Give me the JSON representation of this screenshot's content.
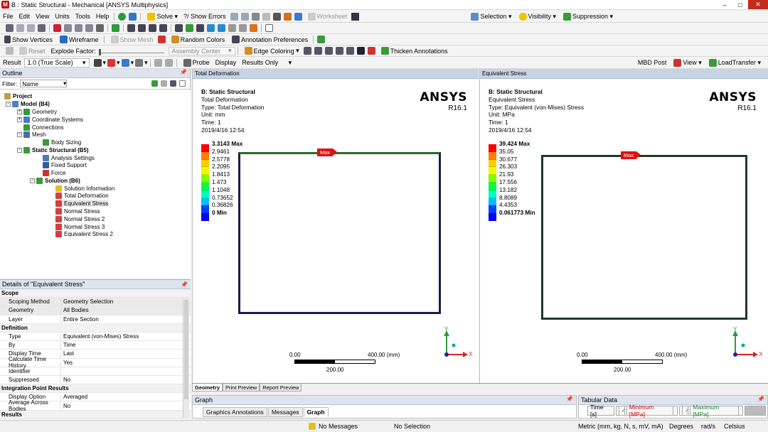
{
  "title": "B : Static Structural - Mechanical [ANSYS Multiphysics]",
  "app_icon": "M",
  "window_buttons": {
    "minimize": "–",
    "maximize": "□",
    "close": "✕"
  },
  "menu": [
    "File",
    "Edit",
    "View",
    "Units",
    "Tools",
    "Help"
  ],
  "toolbar1": {
    "solve": "Solve",
    "show_errors": "?/ Show Errors",
    "worksheet": "Worksheet",
    "selection": "Selection",
    "visibility": "Visibility",
    "suppression": "Suppression"
  },
  "toolbar3": {
    "show_vertices": "Show Vertices",
    "wireframe": "Wireframe",
    "show_mesh": "Show Mesh",
    "random_colors": "Random Colors",
    "annotation_prefs": "Annotation Preferences"
  },
  "toolbar4": {
    "reset": "Reset",
    "explode_factor": "Explode Factor:",
    "assembly_center": "Assembly Center",
    "edge_coloring": "Edge Coloring",
    "thicken": "Thicken Annotations"
  },
  "toolbar5": {
    "result_label": "Result",
    "scale_value": "1.0 (True Scale)",
    "probe": "Probe",
    "display_label": "Display",
    "display_value": "Results Only",
    "mbd_post": "MBD Post",
    "view": "View",
    "load_transfer": "LoadTransfer"
  },
  "outline": {
    "header": "Outline",
    "filter_label": "Filter:",
    "filter_value": "Name",
    "nodes": [
      {
        "label": "Project",
        "bold": true
      },
      {
        "label": "Model (B4)",
        "bold": true
      },
      {
        "label": "Geometry"
      },
      {
        "label": "Coordinate Systems"
      },
      {
        "label": "Connections"
      },
      {
        "label": "Mesh"
      },
      {
        "label": "Body Sizing"
      },
      {
        "label": "Static Structural (B5)",
        "bold": true
      },
      {
        "label": "Analysis Settings"
      },
      {
        "label": "Fixed Support"
      },
      {
        "label": "Force"
      },
      {
        "label": "Solution (B6)",
        "bold": true
      },
      {
        "label": "Solution Information"
      },
      {
        "label": "Total Deformation"
      },
      {
        "label": "Equivalent Stress"
      },
      {
        "label": "Normal Stress"
      },
      {
        "label": "Normal Stress 2"
      },
      {
        "label": "Normal Stress 3"
      },
      {
        "label": "Equivalent Stress 2"
      }
    ]
  },
  "details": {
    "header": "Details of \"Equivalent Stress\"",
    "rows": [
      {
        "group": "Scope"
      },
      {
        "k": "Scoping Method",
        "v": "Geometry Selection",
        "hl": true
      },
      {
        "k": "Geometry",
        "v": "All Bodies",
        "hl": true
      },
      {
        "k": "Layer",
        "v": "Entire Section"
      },
      {
        "group": "Definition"
      },
      {
        "k": "Type",
        "v": "Equivalent (von-Mises) Stress"
      },
      {
        "k": "By",
        "v": "Time"
      },
      {
        "k": "Display Time",
        "v": "Last"
      },
      {
        "k": "Calculate Time History",
        "v": "Yes"
      },
      {
        "k": "Identifier",
        "v": ""
      },
      {
        "k": "Suppressed",
        "v": "No"
      },
      {
        "group": "Integration Point Results"
      },
      {
        "k": "Display Option",
        "v": "Averaged"
      },
      {
        "k": "Average Across Bodies",
        "v": "No"
      },
      {
        "group": "Results"
      }
    ]
  },
  "vp_left": {
    "tab": "Total Deformation",
    "info": [
      "B: Static Structural",
      "Total Deformation",
      "Type: Total Deformation",
      "Unit: mm",
      "Time: 1",
      "2019/4/16 12:54"
    ],
    "brand": "ANSYS",
    "version": "R16.1",
    "legend": [
      "3.3143 Max",
      "2.9461",
      "2.5778",
      "2.2095",
      "1.8413",
      "1.473",
      "1.1048",
      "0.73652",
      "0.36826",
      "0 Min"
    ],
    "max_tag": "Max",
    "scale": {
      "left": "0.00",
      "right": "400.00 (mm)",
      "mid": "200.00"
    }
  },
  "vp_right": {
    "tab": "Equivalent Stress",
    "info": [
      "B: Static Structural",
      "Equivalent Stress",
      "Type: Equivalent (von-Mises) Stress",
      "Unit: MPa",
      "Time: 1",
      "2019/4/16 12:54"
    ],
    "brand": "ANSYS",
    "version": "R16.1",
    "legend": [
      "39.424 Max",
      "35.05",
      "30.677",
      "26.303",
      "21.93",
      "17.556",
      "13.182",
      "8.8089",
      "4.4353",
      "0.061773 Min"
    ],
    "max_tag": "Max",
    "scale": {
      "left": "0.00",
      "right": "400.00 (mm)",
      "mid": "200.00"
    }
  },
  "axis_labels": {
    "x": "X",
    "y": "Y"
  },
  "view_tabs": [
    "Geometry",
    "Print Preview",
    "Report Preview"
  ],
  "graph": {
    "header": "Graph",
    "tabs": [
      "Graphics Annotations",
      "Messages",
      "Graph"
    ]
  },
  "tabular": {
    "header": "Tabular Data",
    "cols": [
      "Time [s]",
      "Minimum [MPa]",
      "Maximum [MPa]"
    ]
  },
  "status": {
    "messages": "No Messages",
    "selection": "No Selection",
    "units": "Metric (mm, kg, N, s, mV, mA)",
    "angle": "Degrees",
    "rate": "rad/s",
    "temp": "Celsius"
  },
  "colors": {
    "legend": [
      "#ff0000",
      "#ff7f00",
      "#ffcc00",
      "#e6ff00",
      "#80ff00",
      "#00ff40",
      "#00ffbf",
      "#00bfff",
      "#0040ff",
      "#0000ff"
    ],
    "accent": "#c7d4e4",
    "max_tag": "#e01010"
  }
}
